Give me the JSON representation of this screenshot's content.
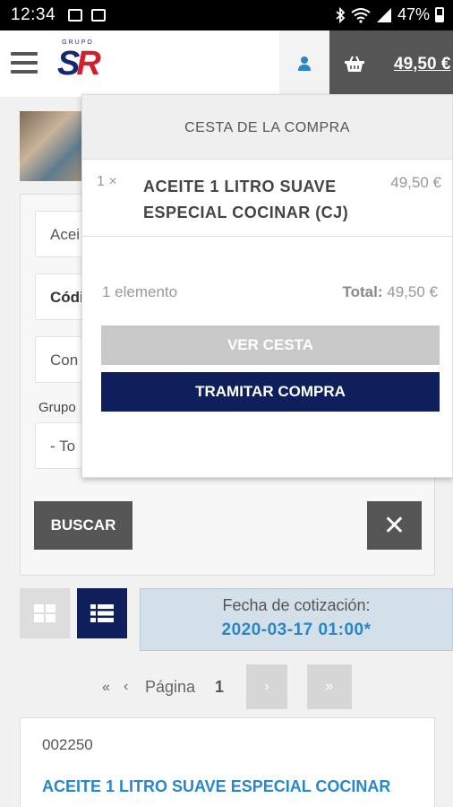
{
  "status_bar": {
    "time": "12:34",
    "battery": "47%"
  },
  "header": {
    "logo_top": "GRUPO",
    "logo_s": "S",
    "logo_r": "R",
    "cart_total": "49,50 €"
  },
  "filters": {
    "field1": "Acei",
    "field2": "Códi",
    "field3": "Con",
    "grupo_label": "Grupo",
    "grupo_select": "- To",
    "search_label": "BUSCAR",
    "clear_symbol": "✕"
  },
  "quote": {
    "label": "Fecha de cotización:",
    "date": "2020-03-17 01:00*"
  },
  "pagination": {
    "first": "«",
    "prev": "‹",
    "label": "Página",
    "page": "1",
    "next": "›",
    "last": "»"
  },
  "product": {
    "code": "002250",
    "name": "ACEITE 1 LITRO SUAVE ESPECIAL COCINAR"
  },
  "cart": {
    "title": "CESTA DE LA COMPRA",
    "items": [
      {
        "qty": "1 ×",
        "name": "ACEITE 1 LITRO SUAVE ESPECIAL COCINAR (CJ)",
        "price": "49,50 €"
      }
    ],
    "count": "1 elemento",
    "total_label": "Total:",
    "total_value": "49,50 €",
    "view_label": "VER CESTA",
    "checkout_label": "TRAMITAR COMPRA"
  },
  "colors": {
    "navy": "#0e1f5b",
    "accent_blue": "#2a86c7",
    "dark_gray": "#555555"
  }
}
